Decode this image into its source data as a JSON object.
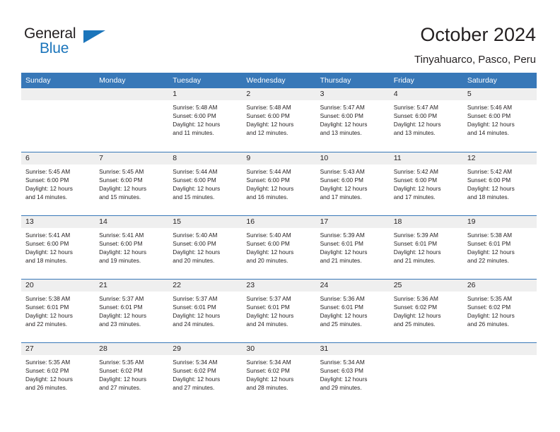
{
  "brand": {
    "name_top": "General",
    "name_bottom": "Blue",
    "triangle_color": "#1b75bb"
  },
  "header": {
    "title": "October 2024",
    "subtitle": "Tinyahuarco, Pasco, Peru"
  },
  "theme": {
    "header_bar": "#3878b8",
    "daynum_band": "#efefef",
    "text": "#231f20",
    "accent": "#1b75bb"
  },
  "calendar": {
    "weekday_headers": [
      "Sunday",
      "Monday",
      "Tuesday",
      "Wednesday",
      "Thursday",
      "Friday",
      "Saturday"
    ],
    "weeks": [
      [
        {
          "day": "",
          "lines": []
        },
        {
          "day": "",
          "lines": []
        },
        {
          "day": "1",
          "lines": [
            "Sunrise: 5:48 AM",
            "Sunset: 6:00 PM",
            "Daylight: 12 hours",
            "and 11 minutes."
          ]
        },
        {
          "day": "2",
          "lines": [
            "Sunrise: 5:48 AM",
            "Sunset: 6:00 PM",
            "Daylight: 12 hours",
            "and 12 minutes."
          ]
        },
        {
          "day": "3",
          "lines": [
            "Sunrise: 5:47 AM",
            "Sunset: 6:00 PM",
            "Daylight: 12 hours",
            "and 13 minutes."
          ]
        },
        {
          "day": "4",
          "lines": [
            "Sunrise: 5:47 AM",
            "Sunset: 6:00 PM",
            "Daylight: 12 hours",
            "and 13 minutes."
          ]
        },
        {
          "day": "5",
          "lines": [
            "Sunrise: 5:46 AM",
            "Sunset: 6:00 PM",
            "Daylight: 12 hours",
            "and 14 minutes."
          ]
        }
      ],
      [
        {
          "day": "6",
          "lines": [
            "Sunrise: 5:45 AM",
            "Sunset: 6:00 PM",
            "Daylight: 12 hours",
            "and 14 minutes."
          ]
        },
        {
          "day": "7",
          "lines": [
            "Sunrise: 5:45 AM",
            "Sunset: 6:00 PM",
            "Daylight: 12 hours",
            "and 15 minutes."
          ]
        },
        {
          "day": "8",
          "lines": [
            "Sunrise: 5:44 AM",
            "Sunset: 6:00 PM",
            "Daylight: 12 hours",
            "and 15 minutes."
          ]
        },
        {
          "day": "9",
          "lines": [
            "Sunrise: 5:44 AM",
            "Sunset: 6:00 PM",
            "Daylight: 12 hours",
            "and 16 minutes."
          ]
        },
        {
          "day": "10",
          "lines": [
            "Sunrise: 5:43 AM",
            "Sunset: 6:00 PM",
            "Daylight: 12 hours",
            "and 17 minutes."
          ]
        },
        {
          "day": "11",
          "lines": [
            "Sunrise: 5:42 AM",
            "Sunset: 6:00 PM",
            "Daylight: 12 hours",
            "and 17 minutes."
          ]
        },
        {
          "day": "12",
          "lines": [
            "Sunrise: 5:42 AM",
            "Sunset: 6:00 PM",
            "Daylight: 12 hours",
            "and 18 minutes."
          ]
        }
      ],
      [
        {
          "day": "13",
          "lines": [
            "Sunrise: 5:41 AM",
            "Sunset: 6:00 PM",
            "Daylight: 12 hours",
            "and 18 minutes."
          ]
        },
        {
          "day": "14",
          "lines": [
            "Sunrise: 5:41 AM",
            "Sunset: 6:00 PM",
            "Daylight: 12 hours",
            "and 19 minutes."
          ]
        },
        {
          "day": "15",
          "lines": [
            "Sunrise: 5:40 AM",
            "Sunset: 6:00 PM",
            "Daylight: 12 hours",
            "and 20 minutes."
          ]
        },
        {
          "day": "16",
          "lines": [
            "Sunrise: 5:40 AM",
            "Sunset: 6:00 PM",
            "Daylight: 12 hours",
            "and 20 minutes."
          ]
        },
        {
          "day": "17",
          "lines": [
            "Sunrise: 5:39 AM",
            "Sunset: 6:01 PM",
            "Daylight: 12 hours",
            "and 21 minutes."
          ]
        },
        {
          "day": "18",
          "lines": [
            "Sunrise: 5:39 AM",
            "Sunset: 6:01 PM",
            "Daylight: 12 hours",
            "and 21 minutes."
          ]
        },
        {
          "day": "19",
          "lines": [
            "Sunrise: 5:38 AM",
            "Sunset: 6:01 PM",
            "Daylight: 12 hours",
            "and 22 minutes."
          ]
        }
      ],
      [
        {
          "day": "20",
          "lines": [
            "Sunrise: 5:38 AM",
            "Sunset: 6:01 PM",
            "Daylight: 12 hours",
            "and 22 minutes."
          ]
        },
        {
          "day": "21",
          "lines": [
            "Sunrise: 5:37 AM",
            "Sunset: 6:01 PM",
            "Daylight: 12 hours",
            "and 23 minutes."
          ]
        },
        {
          "day": "22",
          "lines": [
            "Sunrise: 5:37 AM",
            "Sunset: 6:01 PM",
            "Daylight: 12 hours",
            "and 24 minutes."
          ]
        },
        {
          "day": "23",
          "lines": [
            "Sunrise: 5:37 AM",
            "Sunset: 6:01 PM",
            "Daylight: 12 hours",
            "and 24 minutes."
          ]
        },
        {
          "day": "24",
          "lines": [
            "Sunrise: 5:36 AM",
            "Sunset: 6:01 PM",
            "Daylight: 12 hours",
            "and 25 minutes."
          ]
        },
        {
          "day": "25",
          "lines": [
            "Sunrise: 5:36 AM",
            "Sunset: 6:02 PM",
            "Daylight: 12 hours",
            "and 25 minutes."
          ]
        },
        {
          "day": "26",
          "lines": [
            "Sunrise: 5:35 AM",
            "Sunset: 6:02 PM",
            "Daylight: 12 hours",
            "and 26 minutes."
          ]
        }
      ],
      [
        {
          "day": "27",
          "lines": [
            "Sunrise: 5:35 AM",
            "Sunset: 6:02 PM",
            "Daylight: 12 hours",
            "and 26 minutes."
          ]
        },
        {
          "day": "28",
          "lines": [
            "Sunrise: 5:35 AM",
            "Sunset: 6:02 PM",
            "Daylight: 12 hours",
            "and 27 minutes."
          ]
        },
        {
          "day": "29",
          "lines": [
            "Sunrise: 5:34 AM",
            "Sunset: 6:02 PM",
            "Daylight: 12 hours",
            "and 27 minutes."
          ]
        },
        {
          "day": "30",
          "lines": [
            "Sunrise: 5:34 AM",
            "Sunset: 6:02 PM",
            "Daylight: 12 hours",
            "and 28 minutes."
          ]
        },
        {
          "day": "31",
          "lines": [
            "Sunrise: 5:34 AM",
            "Sunset: 6:03 PM",
            "Daylight: 12 hours",
            "and 29 minutes."
          ]
        },
        {
          "day": "",
          "lines": []
        },
        {
          "day": "",
          "lines": []
        }
      ]
    ]
  }
}
